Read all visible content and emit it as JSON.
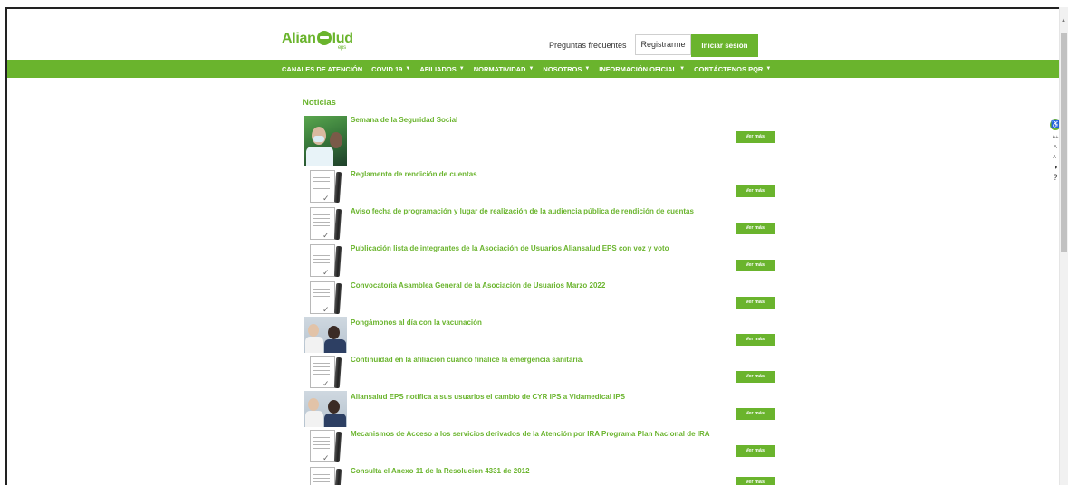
{
  "header": {
    "logo_text_left": "Alian",
    "logo_text_right": "lud",
    "logo_sub": "eps",
    "faq_label": "Preguntas frecuentes",
    "register_label": "Registrarme",
    "login_label": "Iniciar sesión"
  },
  "nav": {
    "items": [
      {
        "label": "CANALES DE ATENCIÓN",
        "caret": ""
      },
      {
        "label": "COVID 19",
        "caret": "▼"
      },
      {
        "label": "AFILIADOS",
        "caret": "▼"
      },
      {
        "label": "NORMATIVIDAD",
        "caret": "▼"
      },
      {
        "label": "NOSOTROS",
        "caret": "▼"
      },
      {
        "label": "INFORMACIÓN OFICIAL",
        "caret": "▼"
      },
      {
        "label": "CONTÁCTENOS PQR",
        "caret": "▼"
      }
    ]
  },
  "main": {
    "section_title": "Noticias",
    "more_label": "Ver más",
    "news": [
      {
        "title": "Semana de la Seguridad Social",
        "thumb": "photo-doctor"
      },
      {
        "title": "Reglamento de rendición de cuentas",
        "thumb": "document-pen-icon"
      },
      {
        "title": "Aviso fecha de programación y lugar de realización de la audiencia pública de rendición de cuentas",
        "thumb": "document-pen-icon"
      },
      {
        "title": "Publicación lista de integrantes de la Asociación de Usuarios Aliansalud EPS con voz y voto",
        "thumb": "document-pen-icon"
      },
      {
        "title": "Convocatoria Asamblea General de la Asociación de Usuarios Marzo 2022",
        "thumb": "document-pen-icon"
      },
      {
        "title": "Pongámonos al día con la vacunación",
        "thumb": "photo-vaccination"
      },
      {
        "title": "Continuidad en la afiliación cuando finalicé la emergencia sanitaria.",
        "thumb": "document-pen-icon"
      },
      {
        "title": "Aliansalud EPS notifica a sus usuarios el cambio de CYR IPS a Vidamedical IPS",
        "thumb": "photo-vaccination"
      },
      {
        "title": "Mecanismos de Acceso a los servicios derivados de la Atención por IRA Programa Plan Nacional de IRA",
        "thumb": "document-pen-icon"
      },
      {
        "title": "Consulta el Anexo 11 de la Resolucion 4331 de 2012",
        "thumb": "document-pen-icon"
      }
    ]
  },
  "a11y": {
    "icon": "accessibility-icon",
    "increase_label": "A+",
    "normal_label": "A",
    "decrease_label": "A-",
    "contrast_label": "◑",
    "help_label": "?"
  },
  "colors": {
    "brand_green": "#6ab42d"
  }
}
